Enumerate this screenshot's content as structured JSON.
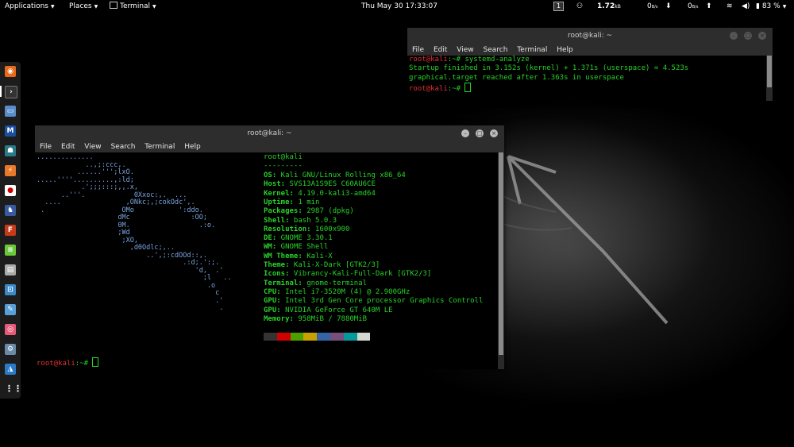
{
  "topbar": {
    "applications": "Applications",
    "places": "Places",
    "terminal": "Terminal",
    "clock": "Thu May 30  17:33:07",
    "workspace": "1",
    "net_speed": "1.72",
    "net_speed_unit": "kB",
    "down_rate": "0",
    "down_unit": "B/s",
    "up_rate": "0",
    "up_unit": "B/s",
    "battery": "83 %"
  },
  "window_small": {
    "title": "root@kali: ~",
    "menu": [
      "File",
      "Edit",
      "View",
      "Search",
      "Terminal",
      "Help"
    ],
    "prompt_user": "root@kali",
    "prompt_sep": ":~#",
    "command": " systemd-analyze",
    "output1": "Startup finished in 3.152s (kernel) + 1.371s (userspace) = 4.523s",
    "output2": "graphical.target reached after 1.363s in userspace"
  },
  "window_main": {
    "title": "root@kali: ~",
    "menu": [
      "File",
      "Edit",
      "View",
      "Search",
      "Terminal",
      "Help"
    ],
    "user_host": "root@kali",
    "separator": "---------",
    "info": [
      {
        "key": "OS:",
        "value": " Kali GNU/Linux Rolling x86_64"
      },
      {
        "key": "Host:",
        "value": " SVS13A1S9ES C60AU6CE"
      },
      {
        "key": "Kernel:",
        "value": " 4.19.0-kali3-amd64"
      },
      {
        "key": "Uptime:",
        "value": " 1 min"
      },
      {
        "key": "Packages:",
        "value": " 2987 (dpkg)"
      },
      {
        "key": "Shell:",
        "value": " bash 5.0.3"
      },
      {
        "key": "Resolution:",
        "value": " 1600x900"
      },
      {
        "key": "DE:",
        "value": " GNOME 3.30.1"
      },
      {
        "key": "WM:",
        "value": " GNOME Shell"
      },
      {
        "key": "WM Theme:",
        "value": " Kali-X"
      },
      {
        "key": "Theme:",
        "value": " Kali-X-Dark [GTK2/3]"
      },
      {
        "key": "Icons:",
        "value": " Vibrancy-Kali-Full-Dark [GTK2/3]"
      },
      {
        "key": "Terminal:",
        "value": " gnome-terminal"
      },
      {
        "key": "CPU:",
        "value": " Intel i7-3520M (4) @ 2.900GHz"
      },
      {
        "key": "GPU:",
        "value": " Intel 3rd Gen Core processor Graphics Controll"
      },
      {
        "key": "GPU:",
        "value": " NVIDIA GeForce GT 640M LE"
      },
      {
        "key": "Memory:",
        "value": " 958MiB / 7880MiB"
      }
    ],
    "palette": [
      "#333333",
      "#d00000",
      "#4aa000",
      "#c8a000",
      "#3465a4",
      "#75507b",
      "#06989a",
      "#d3d7cf"
    ],
    "ascii_art": [
      "..............",
      "            ..,;:ccc,.",
      "          ......''';lxO.",
      ".....''''..........,:ld;",
      "           .';;;:::;,,.x,",
      "      ..'''.            0Xxoc:,.  ...",
      "  ....                ,ONkc;,;cokOdc',.",
      " .                   OMo           ':ddo.",
      "                    dMc               :OO;",
      "                    0M.                 .:o.",
      "                    ;Wd",
      "                     ;XO,",
      "                       ,d0Odlc;,..",
      "                           ..',;:cdOOd::,.",
      "                                    .:d;.':;.",
      "                                       'd,  .'",
      "                                         ;l   ..",
      "                                          .o",
      "                                            c",
      "                                            .'",
      "                                             ."
    ],
    "prompt_user": "root@kali",
    "prompt_sep": ":~#"
  },
  "dock": {
    "icons": [
      "firefox-icon",
      "terminal-icon",
      "files-icon",
      "maltego-icon",
      "metasploit-icon",
      "burpsuite-icon",
      "armitage-icon",
      "beef-icon",
      "faraday-icon",
      "leafpad-icon",
      "cherrytree-icon",
      "recordmydesktop-icon",
      "notes-icon",
      "screenshot-icon",
      "settings-icon",
      "wireshark-icon",
      "show-apps-icon"
    ]
  }
}
